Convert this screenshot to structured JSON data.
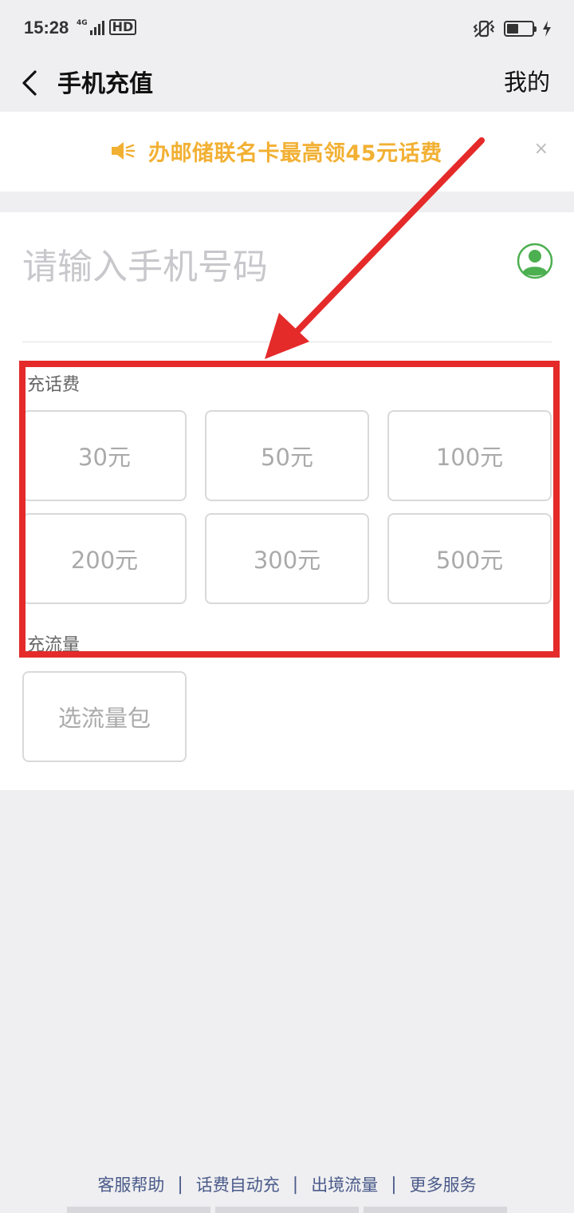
{
  "status_bar": {
    "time": "15:28",
    "network": "4G",
    "hd": "HD",
    "icons": [
      "signal-icon",
      "vibrate-icon",
      "battery-icon",
      "charging-icon"
    ]
  },
  "nav": {
    "title": "手机充值",
    "right_link": "我的",
    "back_icon": "chevron-left-icon"
  },
  "notice": {
    "text": "办邮储联名卡最高领45元话费",
    "close": "×",
    "icon": "speaker-icon",
    "color": "#f2b033"
  },
  "phone_input": {
    "placeholder": "请输入手机号码",
    "value": "",
    "contact_icon": "contact-icon",
    "contact_color": "#4caf50"
  },
  "recharge": {
    "label": "充话费",
    "options": [
      "30元",
      "50元",
      "100元",
      "200元",
      "300元",
      "500元"
    ]
  },
  "data_plan": {
    "label": "充流量",
    "options": [
      "选流量包"
    ]
  },
  "footer": {
    "links": [
      "客服帮助",
      "话费自动充",
      "出境流量",
      "更多服务"
    ]
  },
  "annotation": {
    "color": "#e52a2a"
  }
}
